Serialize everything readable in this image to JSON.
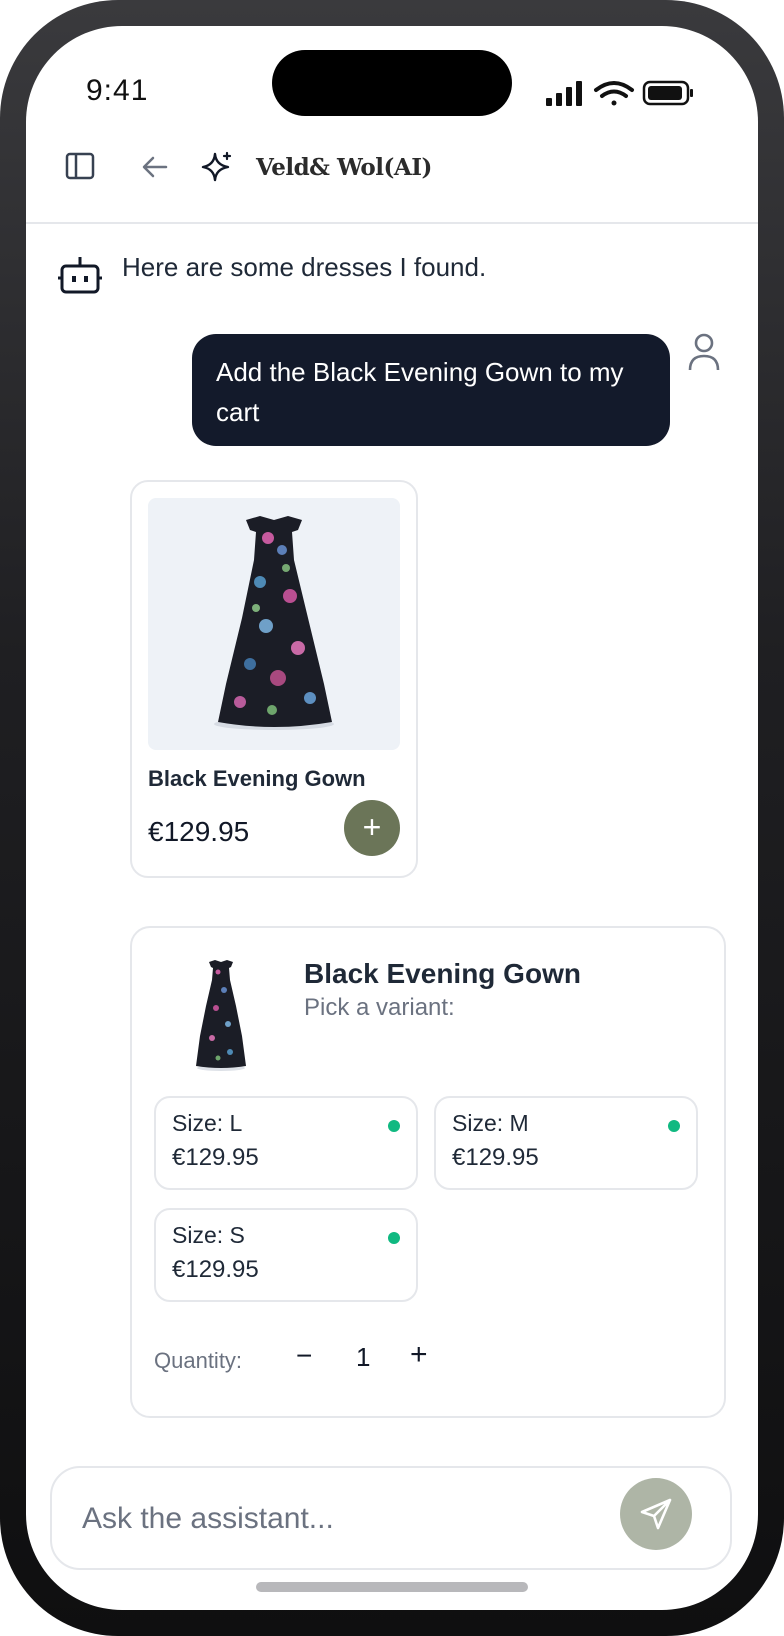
{
  "status_bar": {
    "time": "9:41"
  },
  "app_bar": {
    "brand": "Veld& Wol(AI)",
    "icons": [
      "sidebar-icon",
      "back-arrow-icon",
      "sparkles-icon"
    ]
  },
  "chat": {
    "bot_message": "Here are some dresses I found.",
    "user_message": "Add the Black Evening Gown to my cart"
  },
  "product_card": {
    "name": "Black Evening Gown",
    "price": "€129.95",
    "add_label": "+"
  },
  "variant_picker": {
    "title": "Black Evening Gown",
    "subtitle": "Pick a variant:",
    "options": [
      {
        "size": "Size: L",
        "price": "€129.95",
        "available": true
      },
      {
        "size": "Size: M",
        "price": "€129.95",
        "available": true
      },
      {
        "size": "Size: S",
        "price": "€129.95",
        "available": true
      }
    ],
    "quantity_label": "Quantity:",
    "minus": "−",
    "quantity": "1",
    "plus": "+"
  },
  "composer": {
    "placeholder": "Ask the assistant..."
  },
  "colors": {
    "user_bubble": "#131a2b",
    "add_button": "#6b7558",
    "send_button": "#aeb5a6",
    "available_dot": "#10b981"
  }
}
